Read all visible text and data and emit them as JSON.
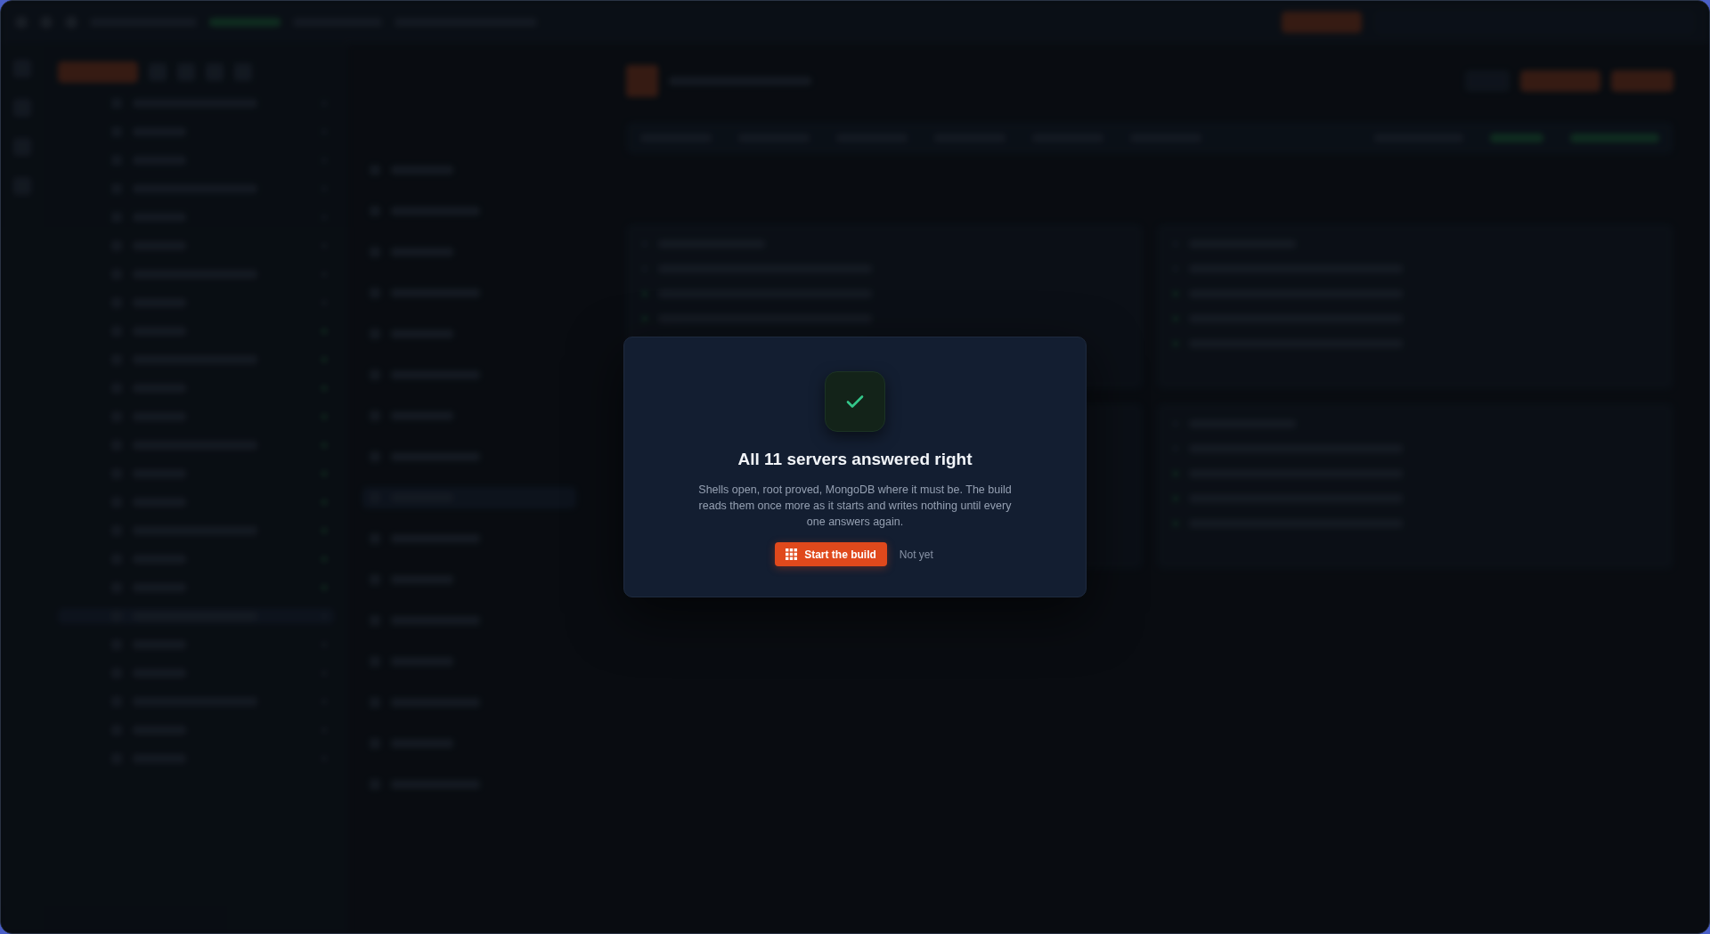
{
  "dialog": {
    "title": "All 11 servers answered right",
    "message": "Shells open, root proved, MongoDB where it must be. The build reads them once more as it starts and writes nothing until every one answers again.",
    "buttons": [
      {
        "label": "Start the build",
        "kind": "primary"
      },
      {
        "label": "Not yet",
        "kind": "plain"
      }
    ]
  }
}
